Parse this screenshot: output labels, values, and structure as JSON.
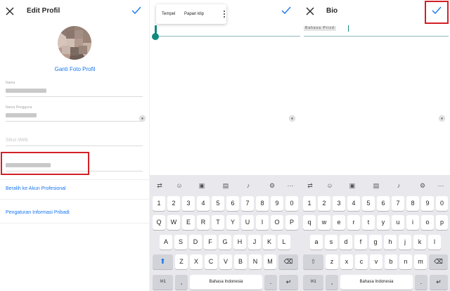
{
  "colors": {
    "accent": "#1877f2",
    "highlight": "#d32027",
    "selection": "#118a7e"
  },
  "panel1": {
    "title": "Edit Profil",
    "change_photo": "Ganti Foto Profil",
    "fields": [
      {
        "label": "Nama"
      },
      {
        "label": "Nama Pengguna"
      },
      {
        "placeholder": "Situs Web"
      },
      {
        "label": ""
      }
    ],
    "links": [
      "Beralih ke Akun Profesional",
      "Pengaturan Informasi Pribadi"
    ]
  },
  "panel2": {
    "context_menu": {
      "paste": "Tempel",
      "clipboard": "Papan klip"
    }
  },
  "panel3": {
    "title": "Bio",
    "bio_value": "Bahasa Prizd"
  },
  "keyboard": {
    "toolbar_icons": [
      "cursor-icon",
      "emoji-icon",
      "sticker-icon",
      "clipboard-icon",
      "mic-icon",
      "gear-icon",
      "more-icon"
    ],
    "row_numbers": [
      "1",
      "2",
      "3",
      "4",
      "5",
      "6",
      "7",
      "8",
      "9",
      "0"
    ],
    "row_q": [
      "Q",
      "W",
      "E",
      "R",
      "T",
      "Y",
      "U",
      "I",
      "O",
      "P"
    ],
    "row_a": [
      "A",
      "S",
      "D",
      "F",
      "G",
      "H",
      "J",
      "K",
      "L"
    ],
    "row_z": [
      "Z",
      "X",
      "C",
      "V",
      "B",
      "N",
      "M"
    ],
    "row_q_lower": [
      "q",
      "w",
      "e",
      "r",
      "t",
      "y",
      "u",
      "i",
      "o",
      "p"
    ],
    "row_a_lower": [
      "a",
      "s",
      "d",
      "f",
      "g",
      "h",
      "j",
      "k",
      "l"
    ],
    "row_z_lower": [
      "z",
      "x",
      "c",
      "v",
      "b",
      "n",
      "m"
    ],
    "symbols_key": "!#1",
    "comma": ",",
    "period": ".",
    "space_label": "Bahasa Indonesia"
  }
}
